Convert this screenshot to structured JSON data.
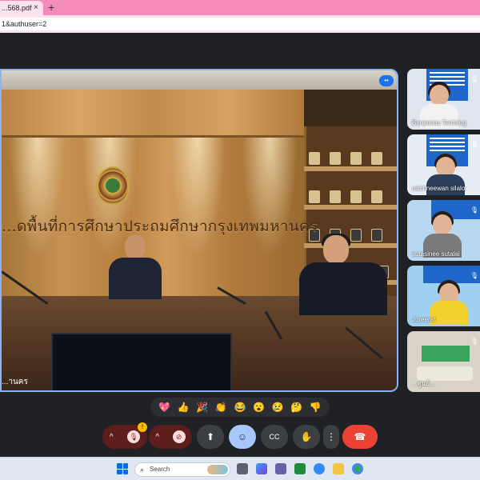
{
  "browser": {
    "tab_title": "...568.pdf",
    "tab_close": "×",
    "new_tab": "+",
    "address": "1&authuser=2"
  },
  "main_video": {
    "wall_sign": "...ดพื้นที่การศึกษาประถมศึกษากรุงเทพมหานคร",
    "corner_label": "...านคร",
    "more_icon": "more-options-icon"
  },
  "participants": [
    {
      "name": "Benjamas Tanteing",
      "mic": "muted"
    },
    {
      "name": "ratchneewan silalo",
      "mic": "muted"
    },
    {
      "name": "sutasinee sutalai",
      "mic": "muted"
    },
    {
      "name": "Jureerat",
      "mic": "muted"
    },
    {
      "name": "...ศูนย์...",
      "mic": "muted"
    }
  ],
  "reactions": [
    "💖",
    "👍",
    "🎉",
    "👏",
    "😂",
    "😮",
    "😢",
    "🤔",
    "👎"
  ],
  "controls": {
    "mic_arrow": "^",
    "mic_icon": "🎙",
    "cam_arrow": "^",
    "cam_icon": "⊘",
    "present_icon": "⬆",
    "emoji_icon": "☺",
    "captions_icon": "CC",
    "hand_icon": "✋",
    "more_icon": "⋮",
    "end_icon": "☎",
    "warning": "!"
  },
  "taskbar": {
    "search_label": "Search",
    "search_icon": "⌕"
  },
  "colors": {
    "tab_strip": "#f58bb8",
    "active_speaker_border": "#8ab4f8",
    "end_call": "#ea4335",
    "meet_bg": "#202124"
  }
}
